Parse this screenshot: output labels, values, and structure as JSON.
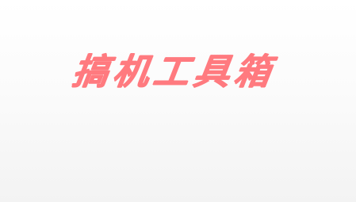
{
  "app": {
    "title": "搞机工具箱"
  },
  "colors": {
    "brand": "#ff7a7f",
    "background_top": "#ffffff",
    "background_bottom": "#f3f3f3"
  }
}
